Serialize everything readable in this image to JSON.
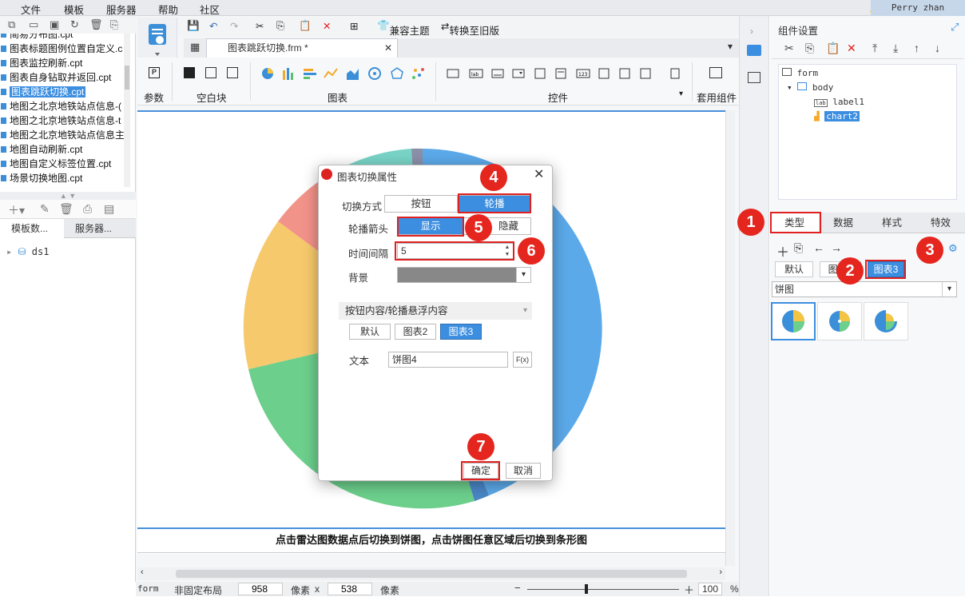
{
  "menu": [
    "文件",
    "模板",
    "服务器",
    "帮助",
    "社区"
  ],
  "user": "Perry zhan",
  "files": [
    {
      "name": "简易分布图.cpt",
      "selected": false
    },
    {
      "name": "图表标题图例位置自定义.c",
      "selected": false
    },
    {
      "name": "图表监控刷新.cpt",
      "selected": false
    },
    {
      "name": "图表自身钻取并返回.cpt",
      "selected": false
    },
    {
      "name": "图表跳跃切换.cpt",
      "selected": true
    },
    {
      "name": "地图之北京地铁站点信息-(",
      "selected": false
    },
    {
      "name": "地图之北京地铁站点信息-t",
      "selected": false
    },
    {
      "name": "地图之北京地铁站点信息主",
      "selected": false
    },
    {
      "name": "地图自动刷新.cpt",
      "selected": false
    },
    {
      "name": "地图自定义标签位置.cpt",
      "selected": false
    },
    {
      "name": "场景切换地图.cpt",
      "selected": false
    }
  ],
  "left_tabs": [
    "模板数...",
    "服务器..."
  ],
  "dataset": "ds1",
  "toolbar": {
    "compat_theme": "兼容主题",
    "switch_old": "转换至旧版"
  },
  "file_tab": "图表跳跃切换.frm *",
  "ribbon_groups": [
    "参数",
    "空白块",
    "图表",
    "控件",
    "套用组件"
  ],
  "caption": "点击雷达图数据点后切换到饼图，点击饼图任意区域后切换到条形图",
  "status": {
    "layout": "form",
    "mode": "非固定布局",
    "width": "958",
    "unit1": "像素",
    "times": "x",
    "height": "538",
    "unit2": "像素",
    "zoom": "100",
    "pct": "%"
  },
  "right_panel": {
    "title": "组件设置",
    "tree": [
      "form",
      "body",
      "label1",
      "chart2"
    ],
    "tabs": [
      "类型",
      "数据",
      "样式",
      "特效"
    ],
    "chart_tabs": [
      "默认",
      "图表2",
      "图表3"
    ],
    "chart_type": "饼图"
  },
  "dialog": {
    "title": "图表切换属性",
    "switch_label": "切换方式",
    "switch_opts": [
      "按钮",
      "轮播"
    ],
    "arrow_label": "轮播箭头",
    "arrow_opts": [
      "显示",
      "隐藏"
    ],
    "interval_label": "时间间隔",
    "interval_value": "5",
    "bg_label": "背景",
    "section": "按钮内容/轮播悬浮内容",
    "content_tabs": [
      "默认",
      "图表2",
      "图表3"
    ],
    "text_label": "文本",
    "text_value": "饼图4",
    "formula": "F(x)",
    "ok": "确定",
    "cancel": "取消"
  },
  "badges": [
    "1",
    "2",
    "3",
    "4",
    "5",
    "6",
    "7"
  ],
  "colors": {
    "accent": "#3c8ee0",
    "annotation": "#e5261f"
  }
}
